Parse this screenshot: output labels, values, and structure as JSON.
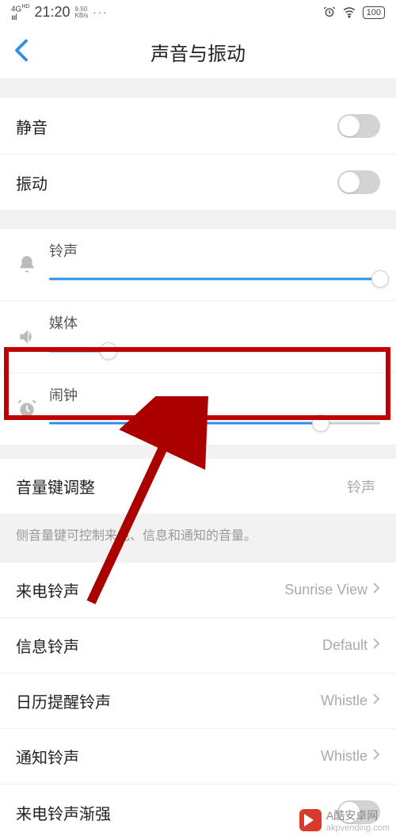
{
  "status": {
    "network": "4G HD",
    "time": "21:20",
    "speed_top": "9.50",
    "speed_unit": "KB/s",
    "battery": "100"
  },
  "nav": {
    "title": "声音与振动"
  },
  "toggles": {
    "mute": {
      "label": "静音"
    },
    "vibrate": {
      "label": "振动"
    }
  },
  "sliders": {
    "ringtone": {
      "label": "铃声",
      "percent": 100
    },
    "media": {
      "label": "媒体",
      "percent": 18
    },
    "alarm": {
      "label": "闹钟",
      "percent": 82
    }
  },
  "volume_key": {
    "label": "音量键调整",
    "value": "铃声",
    "desc": "侧音量键可控制来电、信息和通知的音量。"
  },
  "ringtones": {
    "incoming": {
      "label": "来电铃声",
      "value": "Sunrise View"
    },
    "message": {
      "label": "信息铃声",
      "value": "Default"
    },
    "calendar": {
      "label": "日历提醒铃声",
      "value": "Whistle"
    },
    "notification": {
      "label": "通知铃声",
      "value": "Whistle"
    },
    "ascending": {
      "label": "来电铃声渐强"
    }
  },
  "watermark": {
    "text": "A酷安卓网",
    "domain": "akpvending.com"
  }
}
